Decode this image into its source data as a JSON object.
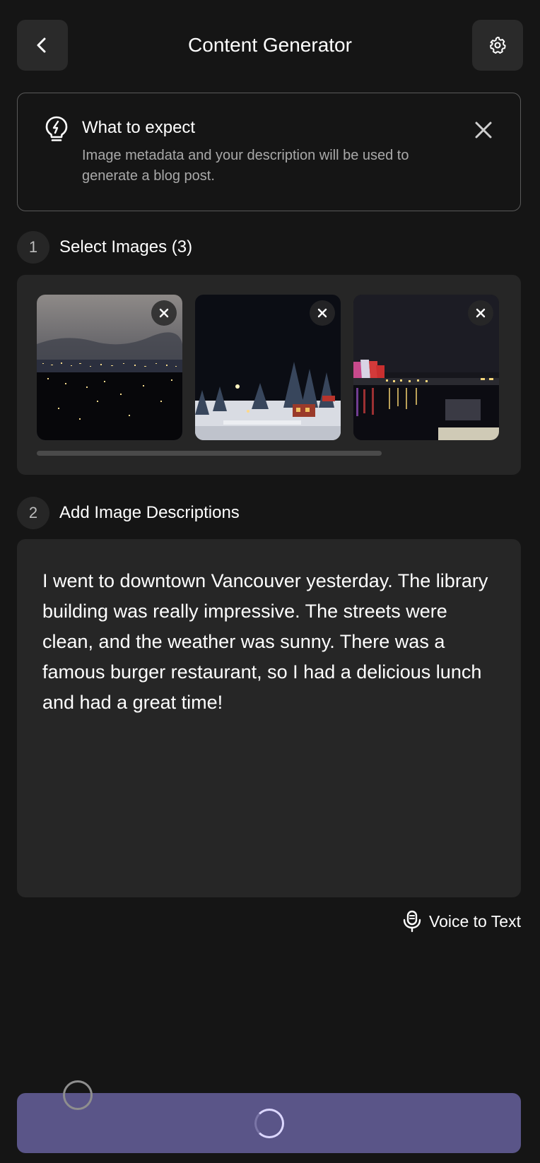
{
  "header": {
    "title": "Content Generator",
    "back_icon": "chevron-left-icon",
    "settings_icon": "gear-icon"
  },
  "info_card": {
    "title": "What to expect",
    "description": "Image metadata and your description will be used to generate a blog post.",
    "icon": "lightbulb-icon",
    "close_icon": "close-icon"
  },
  "step1": {
    "number": "1",
    "label": "Select Images (3)"
  },
  "images": [
    {
      "name": "night-cityscape-photo"
    },
    {
      "name": "christmas-village-photo"
    },
    {
      "name": "harbour-lights-photo"
    }
  ],
  "step2": {
    "number": "2",
    "label": "Add Image Descriptions"
  },
  "description": {
    "text": "I went to downtown Vancouver yesterday. The library building was really impressive. The streets were clean, and the weather was sunny. There was a famous burger restaurant, so I had a delicious lunch and had a great time!"
  },
  "voice": {
    "label": "Voice to Text",
    "icon": "microphone-icon"
  },
  "generate": {
    "state": "loading",
    "icon": "spinner-icon"
  },
  "colors": {
    "background": "#151515",
    "panel": "#262626",
    "button": "#5a5588",
    "muted_text": "#a9a9a9"
  }
}
